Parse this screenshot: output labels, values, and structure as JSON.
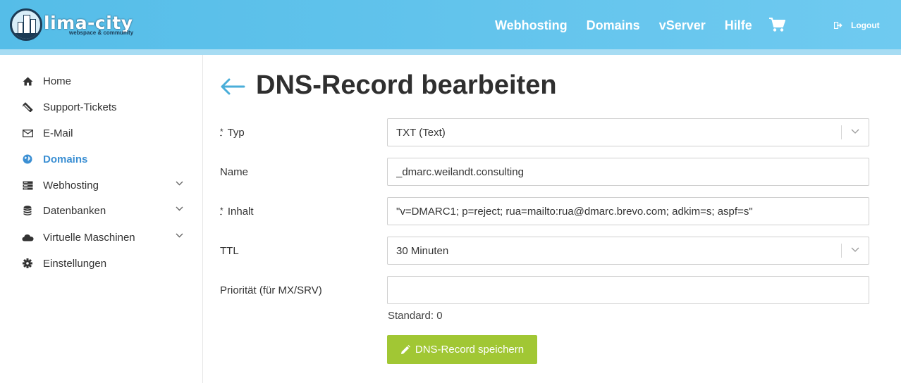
{
  "brand": {
    "name": "lima-city",
    "tagline": "webspace & community"
  },
  "colors": {
    "header": "#5cc1eb",
    "accent": "#3b8fd3",
    "save_button": "#a1c734"
  },
  "nav": {
    "webhosting": "Webhosting",
    "domains": "Domains",
    "vserver": "vServer",
    "hilfe": "Hilfe",
    "cart_icon": "shopping-cart-icon",
    "logout": "Logout"
  },
  "sidebar": {
    "items": [
      {
        "label": "Home",
        "icon": "home-icon"
      },
      {
        "label": "Support-Tickets",
        "icon": "ticket-icon"
      },
      {
        "label": "E-Mail",
        "icon": "envelope-icon"
      },
      {
        "label": "Domains",
        "icon": "globe-icon",
        "active": true
      },
      {
        "label": "Webhosting",
        "icon": "server-icon",
        "expandable": true
      },
      {
        "label": "Datenbanken",
        "icon": "database-icon",
        "expandable": true
      },
      {
        "label": "Virtuelle Maschinen",
        "icon": "cloud-icon",
        "expandable": true
      },
      {
        "label": "Einstellungen",
        "icon": "gear-icon"
      }
    ]
  },
  "page": {
    "title": "DNS-Record bearbeiten"
  },
  "form": {
    "required_mark": "*",
    "typ": {
      "label": "Typ",
      "value": "TXT (Text)"
    },
    "name": {
      "label": "Name",
      "value": "_dmarc.weilandt.consulting"
    },
    "inhalt": {
      "label": "Inhalt",
      "value": "\"v=DMARC1; p=reject; rua=mailto:rua@dmarc.brevo.com; adkim=s; aspf=s\""
    },
    "ttl": {
      "label": "TTL",
      "value": "30 Minuten"
    },
    "prioritaet": {
      "label": "Priorität (für MX/SRV)",
      "value": "",
      "hint": "Standard: 0"
    },
    "save_label": "DNS-Record speichern"
  }
}
